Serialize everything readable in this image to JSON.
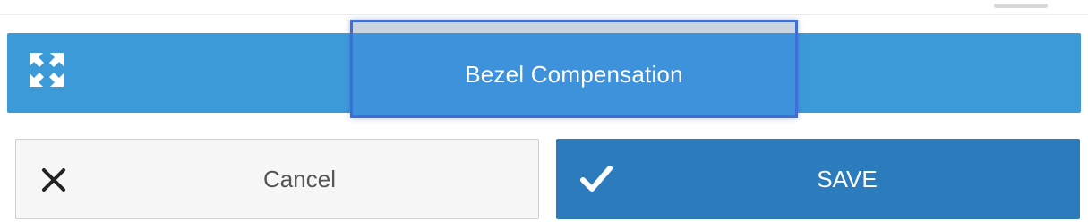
{
  "header": {
    "title": "Bezel Compensation",
    "icon": "expand-arrows-icon",
    "color": "#3d9ad9"
  },
  "actions": {
    "cancel_label": "Cancel",
    "cancel_icon": "close-icon",
    "save_label": "SAVE",
    "save_icon": "checkmark-icon",
    "save_color": "#2c7cbd"
  }
}
